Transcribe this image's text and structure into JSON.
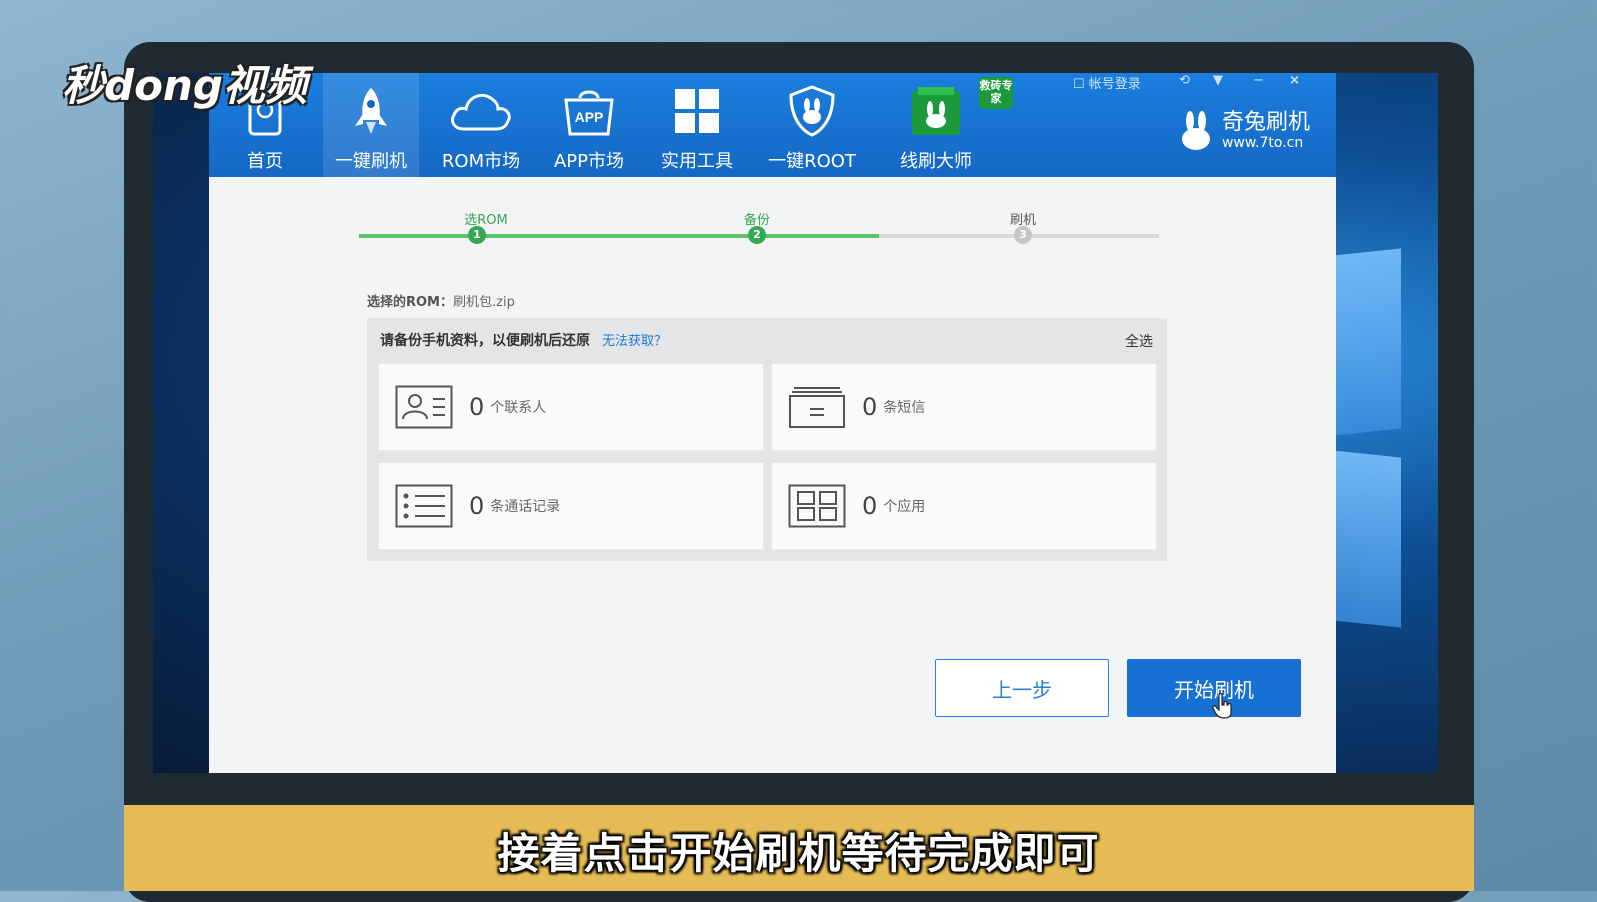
{
  "watermark": "秒dong视频",
  "caption": "接着点击开始刷机等待完成即可",
  "nav": [
    {
      "label": "首页",
      "icon": "phone-home-icon"
    },
    {
      "label": "一键刷机",
      "icon": "rocket-icon"
    },
    {
      "label": "ROM市场",
      "icon": "cloud-icon"
    },
    {
      "label": "APP市场",
      "icon": "app-bag-icon"
    },
    {
      "label": "实用工具",
      "icon": "grid-tools-icon"
    },
    {
      "label": "一键ROOT",
      "icon": "shield-rabbit-icon"
    },
    {
      "label": "线刷大师",
      "icon": "rabbit-box-icon"
    }
  ],
  "expert_badge": "救砖专家",
  "window_controls": {
    "login": "帐号登录",
    "minimize": "−",
    "close": "×"
  },
  "brand": {
    "name": "奇兔刷机",
    "url": "www.7to.cn"
  },
  "steps": [
    {
      "label": "选ROM",
      "num": "1",
      "state": "done"
    },
    {
      "label": "备份",
      "num": "2",
      "state": "active"
    },
    {
      "label": "刷机",
      "num": "3",
      "state": "pending"
    }
  ],
  "rom": {
    "label": "选择的ROM：",
    "value": "刷机包.zip"
  },
  "backup": {
    "title": "请备份手机资料，以便刷机后还原",
    "link": "无法获取？",
    "select_all": "全选",
    "items": [
      {
        "count": "0",
        "text": "个联系人",
        "icon": "contact-card-icon"
      },
      {
        "count": "0",
        "text": "条短信",
        "icon": "sms-icon"
      },
      {
        "count": "0",
        "text": "条通话记录",
        "icon": "call-log-icon"
      },
      {
        "count": "0",
        "text": "个应用",
        "icon": "apps-icon"
      }
    ]
  },
  "buttons": {
    "prev": "上一步",
    "start": "开始刷机"
  },
  "colors": {
    "accent": "#1671d3",
    "step_done": "#34a853",
    "caption_bar": "#e4bb54"
  }
}
